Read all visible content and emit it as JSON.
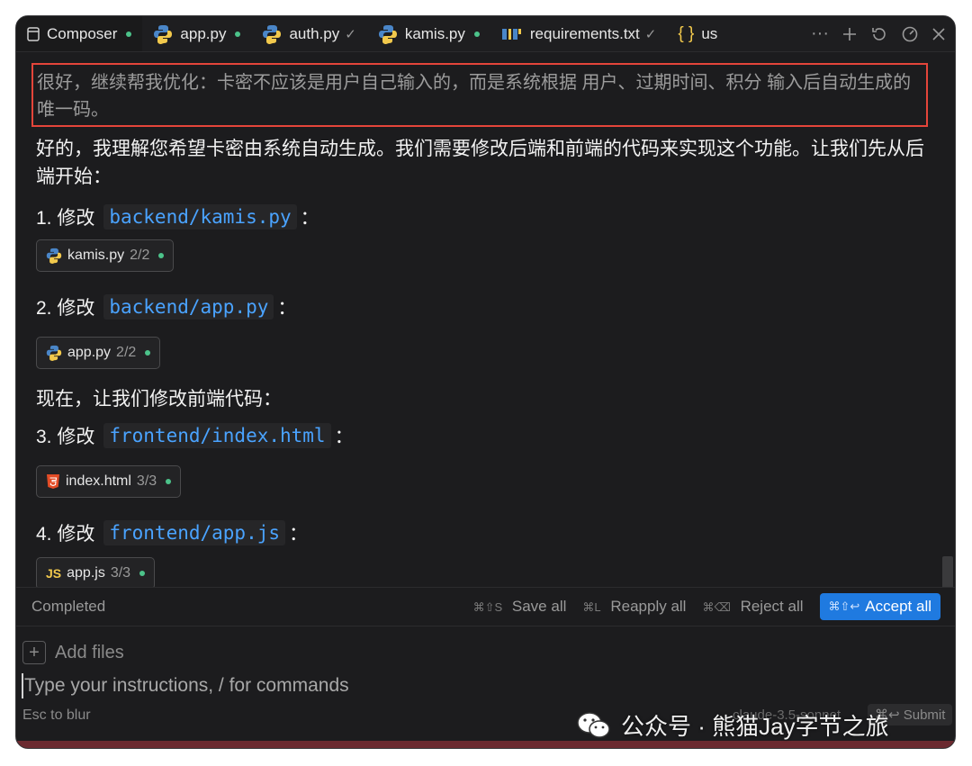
{
  "tabs": [
    {
      "label": "Composer",
      "icon": "composer-icon",
      "status": "dot"
    },
    {
      "label": "app.py",
      "icon": "python-icon",
      "status": "dot"
    },
    {
      "label": "auth.py",
      "icon": "python-icon",
      "status": "check"
    },
    {
      "label": "kamis.py",
      "icon": "python-icon",
      "status": "dot"
    },
    {
      "label": "requirements.txt",
      "icon": "pip-icon",
      "status": "check"
    },
    {
      "label": "us",
      "icon": "json-braces-icon",
      "status": ""
    }
  ],
  "tab_status_glyphs": {
    "check": "✓"
  },
  "user_message": "很好，继续帮我优化：卡密不应该是用户自己输入的，而是系统根据 用户、过期时间、积分 输入后自动生成的唯一码。",
  "assistant": {
    "intro": "好的，我理解您希望卡密由系统自动生成。我们需要修改后端和前端的代码来实现这个功能。让我们先从后端开始：",
    "between": "现在，让我们修改前端代码：",
    "steps": [
      {
        "prefix": "1. 修改",
        "path": "backend/kamis.py",
        "suffix": "：",
        "chip": {
          "file": "kamis.py",
          "count": "2/2",
          "icon": "python-icon"
        }
      },
      {
        "prefix": "2. 修改",
        "path": "backend/app.py",
        "suffix": "：",
        "chip": {
          "file": "app.py",
          "count": "2/2",
          "icon": "python-icon"
        }
      },
      {
        "prefix": "3. 修改",
        "path": "frontend/index.html",
        "suffix": "：",
        "chip": {
          "file": "index.html",
          "count": "3/3",
          "icon": "html5-icon"
        }
      },
      {
        "prefix": "4. 修改",
        "path": "frontend/app.js",
        "suffix": "：",
        "chip": {
          "file": "app.js",
          "count": "3/3",
          "icon": "javascript-icon"
        }
      }
    ]
  },
  "statusbar": {
    "status": "Completed",
    "save_all": {
      "keys": "⌘⇧S",
      "label": "Save all"
    },
    "reapply_all": {
      "keys": "⌘L",
      "label": "Reapply all"
    },
    "reject_all": {
      "keys": "⌘⌫",
      "label": "Reject all"
    },
    "accept_all": {
      "keys": "⌘⇧↩",
      "label": "Accept all"
    }
  },
  "input": {
    "add_files": "Add files",
    "placeholder": "Type your instructions, / for commands",
    "esc_hint": "Esc to blur",
    "model_hint": "claude-3.5-sonnet",
    "submit_hint": "⌘↩ Submit"
  },
  "watermark": "公众号 · 熊猫Jay字节之旅",
  "colors": {
    "accent": "#1f7ae0",
    "highlight_border": "#e4453a",
    "link": "#4aa3ff",
    "dot": "#4cc38a"
  }
}
